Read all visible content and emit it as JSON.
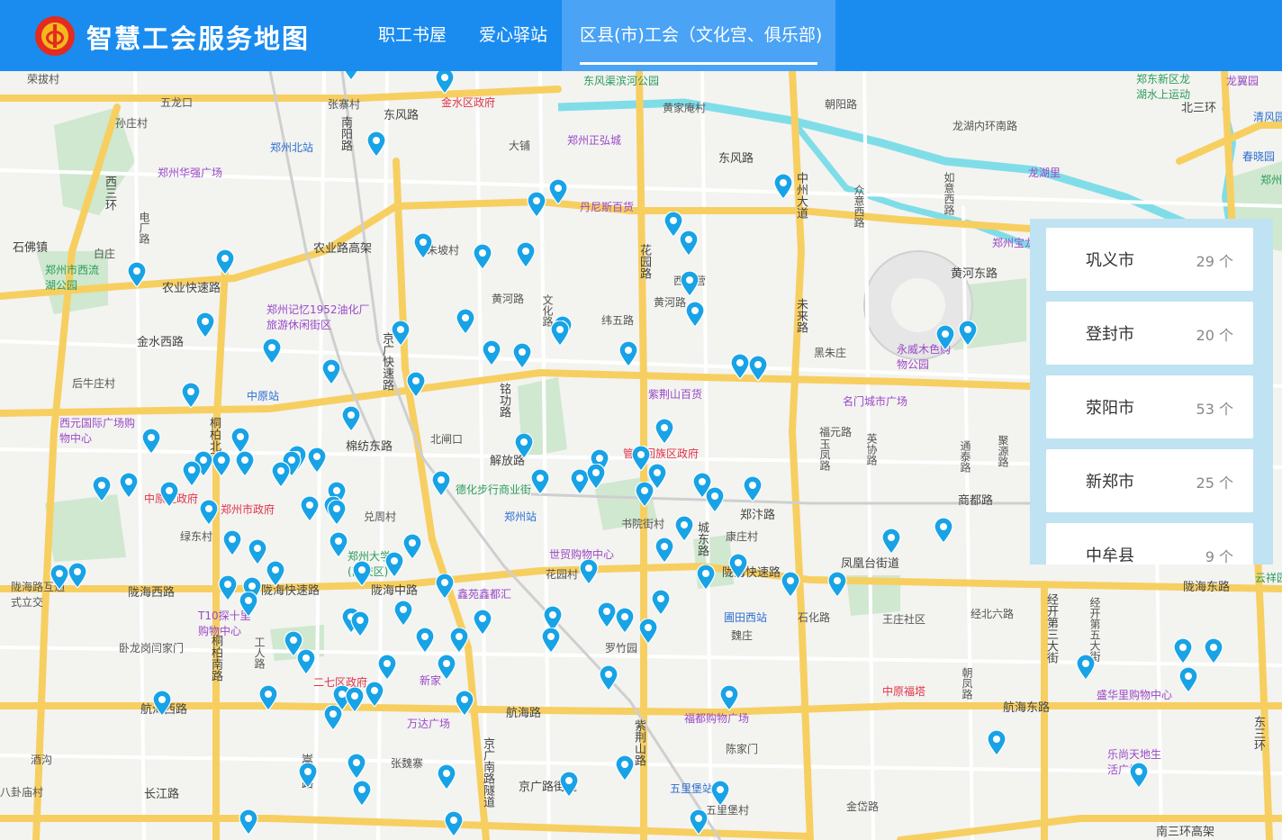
{
  "header": {
    "title": "智慧工会服务地图",
    "nav": [
      {
        "label": "职工书屋"
      },
      {
        "label": "爱心驿站"
      },
      {
        "label": "区县(市)工会（文化宫、俱乐部)"
      }
    ]
  },
  "panel": {
    "items": [
      {
        "name": "巩义市",
        "count": "29 个"
      },
      {
        "name": "登封市",
        "count": "20 个"
      },
      {
        "name": "荥阳市",
        "count": "53 个"
      },
      {
        "name": "新郑市",
        "count": "25 个"
      },
      {
        "name": "中牟县",
        "count": "9 个"
      }
    ]
  },
  "map": {
    "labels": [
      {
        "text": "五龙口"
      },
      {
        "text": "孙庄村"
      },
      {
        "text": "郑州华强广场"
      },
      {
        "text": "西三环"
      },
      {
        "text": "电厂路"
      },
      {
        "text": "石佛镇"
      },
      {
        "text": "白庄"
      },
      {
        "text": "郑州市西流湖公园"
      },
      {
        "text": "农业快速路"
      },
      {
        "text": "金水西路"
      },
      {
        "text": "后牛庄村"
      },
      {
        "text": "西元国际广场购物中心"
      },
      {
        "text": "桐柏北路"
      },
      {
        "text": "中原区政府"
      },
      {
        "text": "郑州市政府"
      },
      {
        "text": "绿东村"
      },
      {
        "text": "陇海路互通式立交"
      },
      {
        "text": "陇海西路"
      },
      {
        "text": "陇海快速路"
      },
      {
        "text": "T10探十里购物中心"
      },
      {
        "text": "卧龙岗闫家门"
      },
      {
        "text": "桐柏南路"
      },
      {
        "text": "工人路"
      },
      {
        "text": "航海西路"
      },
      {
        "text": "酒沟"
      },
      {
        "text": "八卦庙村"
      },
      {
        "text": "长江路"
      },
      {
        "text": "嵩山路"
      },
      {
        "text": "张寨村"
      },
      {
        "text": "南阳路"
      },
      {
        "text": "东风路"
      },
      {
        "text": "郑州北站"
      },
      {
        "text": "金水区政府"
      },
      {
        "text": "大铺"
      },
      {
        "text": "郑州正弘城"
      },
      {
        "text": "丹尼斯百货"
      },
      {
        "text": "农业路高架"
      },
      {
        "text": "郑州记忆1952油化厂旅游休闲街区"
      },
      {
        "text": "中原站"
      },
      {
        "text": "棉纺东路"
      },
      {
        "text": "京广快速路"
      },
      {
        "text": "黄河路"
      },
      {
        "text": "纬五路"
      },
      {
        "text": "花园路"
      },
      {
        "text": "文化路"
      },
      {
        "text": "紫荆山百货"
      },
      {
        "text": "铭功路"
      },
      {
        "text": "北闸口"
      },
      {
        "text": "解放路"
      },
      {
        "text": "德化步行商业街"
      },
      {
        "text": "郑州站"
      },
      {
        "text": "兑周村"
      },
      {
        "text": "郑州大学(南校区)"
      },
      {
        "text": "陇海中路"
      },
      {
        "text": "鑫苑鑫都汇"
      },
      {
        "text": "万达广场"
      },
      {
        "text": "二七区政府"
      },
      {
        "text": "新家"
      },
      {
        "text": "航海路"
      },
      {
        "text": "京广南路隧道"
      },
      {
        "text": "张魏寨"
      },
      {
        "text": "京广路街道"
      },
      {
        "text": "五里堡站"
      },
      {
        "text": "五里堡村"
      },
      {
        "text": "紫荆山路"
      },
      {
        "text": "管城回族区政府"
      },
      {
        "text": "书院街村"
      },
      {
        "text": "世贸购物中心"
      },
      {
        "text": "花园村"
      },
      {
        "text": "罗竹园"
      },
      {
        "text": "福都购物广场"
      },
      {
        "text": "陈家门"
      },
      {
        "text": "圃田西站"
      },
      {
        "text": "魏庄"
      },
      {
        "text": "康庄村"
      },
      {
        "text": "城东路"
      },
      {
        "text": "郑汴路"
      },
      {
        "text": "黄家庵村"
      },
      {
        "text": "朝阳路"
      },
      {
        "text": "东风渠滨河公园"
      },
      {
        "text": "龙湖内环南路"
      },
      {
        "text": "中州大道"
      },
      {
        "text": "众意西路"
      },
      {
        "text": "如意西路"
      },
      {
        "text": "黄河东路"
      },
      {
        "text": "未来路"
      },
      {
        "text": "黑朱庄"
      },
      {
        "text": "名门城市广场"
      },
      {
        "text": "福元路"
      },
      {
        "text": "玉凤路"
      },
      {
        "text": "英协路"
      },
      {
        "text": "通泰路"
      },
      {
        "text": "聚源路"
      },
      {
        "text": "商都路"
      },
      {
        "text": "凤凰台街道"
      },
      {
        "text": "陇海快速路"
      },
      {
        "text": "石化路"
      },
      {
        "text": "王庄社区"
      },
      {
        "text": "经北六路"
      },
      {
        "text": "经开第三大街"
      },
      {
        "text": "经开第五大街"
      },
      {
        "text": "中原福塔"
      },
      {
        "text": "朝凤路"
      },
      {
        "text": "盛华里购物中心"
      },
      {
        "text": "航海东路"
      },
      {
        "text": "乐尚天地生活广场"
      },
      {
        "text": "南三环高架"
      },
      {
        "text": "金岱路"
      },
      {
        "text": "永威木色购物公园"
      },
      {
        "text": "郑州宝龙"
      },
      {
        "text": "龙湖里"
      },
      {
        "text": "北三环"
      },
      {
        "text": "郑东新区龙湖水上运动"
      },
      {
        "text": "龙翼园"
      },
      {
        "text": "清风园"
      },
      {
        "text": "春晓园"
      },
      {
        "text": "郑州"
      },
      {
        "text": "东三环"
      },
      {
        "text": "陇海东路"
      },
      {
        "text": "云祥园"
      },
      {
        "text": "西苍营"
      },
      {
        "text": "黄河路"
      },
      {
        "text": "荣拔村"
      },
      {
        "text": "东风路"
      },
      {
        "text": "朱坡村"
      }
    ]
  },
  "colors": {
    "header_bg": "#1a8cf0",
    "nav_active_bg": "#4aa3f5",
    "pin": "#18a3e6",
    "panel_bg": "#bfe3f2"
  }
}
